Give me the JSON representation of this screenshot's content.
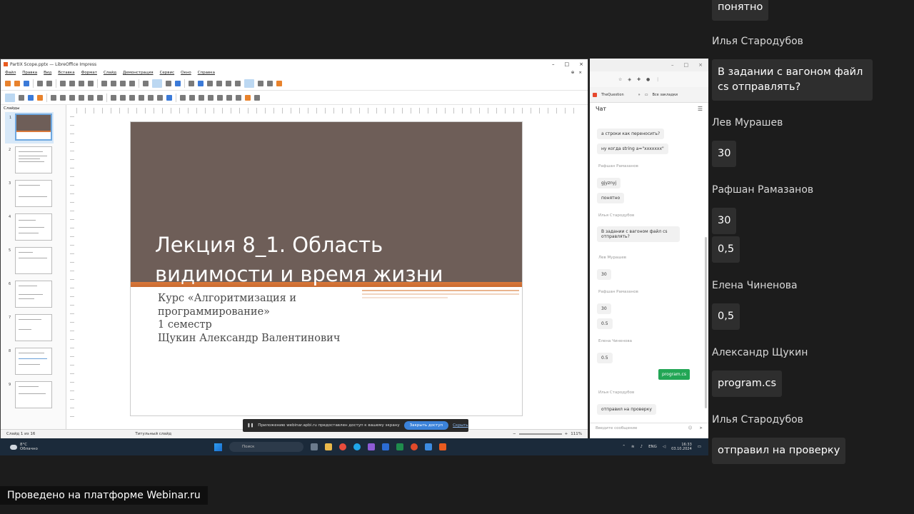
{
  "impress": {
    "window_title": "PartIX Scope.pptx — LibreOffice Impress",
    "menu": [
      "Файл",
      "Правка",
      "Вид",
      "Вставка",
      "Формат",
      "Слайд",
      "Демонстрация",
      "Сервис",
      "Окно",
      "Справка"
    ],
    "slides_pane_title": "Слайды",
    "thumbnail_numbers": [
      "1",
      "2",
      "3",
      "4",
      "5",
      "6",
      "7",
      "8",
      "9"
    ],
    "slide": {
      "title_line1": "Лекция 8_1. Область",
      "title_line2": "видимости и время жизни",
      "subtitle_lines": [
        "Курс «Алгоритмизация и",
        "программирование»",
        "1 семестр",
        "Щукин Александр Валентинович"
      ]
    },
    "status": {
      "slide_counter": "Слайд 1 из 16",
      "layout": "Титульный слайд",
      "zoom": "111%"
    },
    "colors": {
      "slide_brown": "#6e5e58",
      "slide_orange": "#d9783a"
    }
  },
  "share_notice": {
    "text": "Приложению webinar.apbi.ru предоставлен доступ к вашему экрану",
    "stop_button": "Закрыть доступ",
    "hide_link": "Скрыть"
  },
  "browser": {
    "bookmark_tab": "TheQuestion",
    "all_bookmarks": "Все закладки",
    "chat_title": "Чат",
    "messages": [
      {
        "type": "bub",
        "text": "а строки как переносить?"
      },
      {
        "type": "bub",
        "text": "ну когда string a=\"xxxxxxx\""
      },
      {
        "type": "name",
        "text": "Рафшан Рамазанов"
      },
      {
        "type": "bub",
        "text": "gjyznyj"
      },
      {
        "type": "bub",
        "text": "понятно"
      },
      {
        "type": "name",
        "text": "Илья Стародубов"
      },
      {
        "type": "bub",
        "text": "В задании с вагоном файл cs отправлять?"
      },
      {
        "type": "name",
        "text": "Лев Мурашев"
      },
      {
        "type": "bub",
        "text": "30"
      },
      {
        "type": "name",
        "text": "Рафшан Рамазанов"
      },
      {
        "type": "bub",
        "text": "30"
      },
      {
        "type": "bub",
        "text": "0.5"
      },
      {
        "type": "name",
        "text": "Елена Чиненова"
      },
      {
        "type": "bub",
        "text": "0.5"
      },
      {
        "type": "green",
        "text": "program.cs"
      },
      {
        "type": "name",
        "text": "Илья Стародубов"
      },
      {
        "type": "bub",
        "text": "отправил на проверку"
      }
    ],
    "input_placeholder": "Введите сообщение"
  },
  "taskbar": {
    "weather_temp": "8°C",
    "weather_desc": "Облачно",
    "search_placeholder": "Поиск",
    "lang": "ENG",
    "time": "16:33",
    "date": "03.10.2024"
  },
  "chat_panel": {
    "items": [
      {
        "kind": "bubble",
        "text": "понятно"
      },
      {
        "kind": "name",
        "text": "Илья Стародубов"
      },
      {
        "kind": "bubble",
        "text": "В задании с вагоном файл cs отправлять?"
      },
      {
        "kind": "name",
        "text": "Лев Мурашев"
      },
      {
        "kind": "bubble",
        "text": "30"
      },
      {
        "kind": "name",
        "text": "Рафшан Рамазанов"
      },
      {
        "kind": "bubble",
        "text": "30"
      },
      {
        "kind": "bubble",
        "text": "0,5"
      },
      {
        "kind": "name",
        "text": "Елена Чиненова"
      },
      {
        "kind": "bubble",
        "text": "0,5"
      },
      {
        "kind": "name",
        "text": "Александр Щукин"
      },
      {
        "kind": "bubble",
        "text": "program.cs"
      },
      {
        "kind": "name",
        "text": "Илья Стародубов"
      },
      {
        "kind": "bubble",
        "text": "отправил на проверку"
      }
    ]
  },
  "footer": {
    "platform_text": "Проведено на платформе Webinar.ru"
  }
}
